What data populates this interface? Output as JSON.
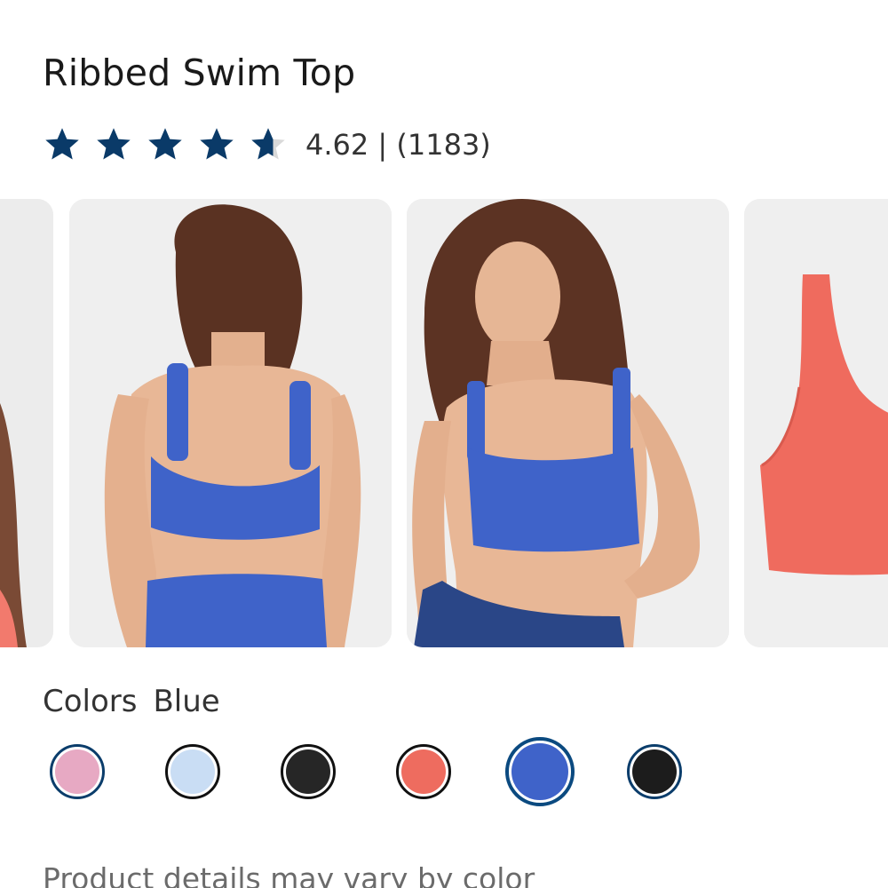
{
  "product": {
    "title": "Ribbed Swim Top",
    "rating_value": 4.62,
    "rating_text": "4.62 | (1183)",
    "star_color": "#0a3a68",
    "stars": [
      "full",
      "full",
      "full",
      "full",
      "partial"
    ]
  },
  "gallery": {
    "images": [
      {
        "name": "partial-left-image",
        "desc": "swim top, coral"
      },
      {
        "name": "back-view-blue-image",
        "desc": "blue ribbed swim top back view"
      },
      {
        "name": "front-view-blue-image",
        "desc": "blue ribbed swim top front view"
      },
      {
        "name": "coral-product-image",
        "desc": "coral ribbed swim top flat"
      }
    ]
  },
  "colors": {
    "label": "Colors",
    "selected_name": "Blue",
    "swatches": [
      {
        "name": "pink",
        "hex": "#e7a9c3",
        "selected": false
      },
      {
        "name": "light-blue",
        "hex": "#c9ddf4",
        "selected": false
      },
      {
        "name": "black",
        "hex": "#262626",
        "selected": false
      },
      {
        "name": "coral",
        "hex": "#ee6c5f",
        "selected": false
      },
      {
        "name": "blue",
        "hex": "#3f63c9",
        "selected": true
      },
      {
        "name": "black-ribbed",
        "hex": "#1c1c1c",
        "selected": false
      }
    ]
  },
  "note": "Product details may vary by color"
}
